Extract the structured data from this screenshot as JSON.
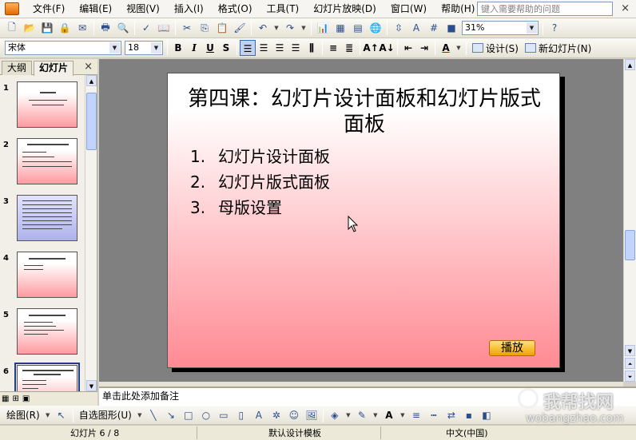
{
  "menubar": {
    "items": [
      "文件(F)",
      "编辑(E)",
      "视图(V)",
      "插入(I)",
      "格式(O)",
      "工具(T)",
      "幻灯片放映(D)",
      "窗口(W)",
      "帮助(H)"
    ],
    "help_placeholder": "键入需要帮助的问题",
    "close": "×"
  },
  "standard_toolbar": {
    "zoom": "31%",
    "help": "?"
  },
  "format_toolbar": {
    "font": "宋体",
    "size": "18",
    "bold": "B",
    "italic": "I",
    "underline": "U",
    "shadow": "S",
    "design": "设计(S)",
    "new_slide": "新幻灯片(N)"
  },
  "left_pane": {
    "tab_outline": "大纲",
    "tab_slides": "幻灯片",
    "close": "×",
    "thumbnails": [
      "1",
      "2",
      "3",
      "4",
      "5",
      "6"
    ]
  },
  "slide": {
    "title": "第四课：幻灯片设计面板和幻灯片版式面板",
    "items": [
      {
        "num": "1.",
        "text": "幻灯片设计面板"
      },
      {
        "num": "2.",
        "text": "幻灯片版式面板"
      },
      {
        "num": "3.",
        "text": "母版设置"
      }
    ],
    "play_button": "播放",
    "gradient_color": "#ff8a93"
  },
  "notes": {
    "placeholder": "单击此处添加备注"
  },
  "drawing_toolbar": {
    "draw": "绘图(R)",
    "autoshapes": "自选图形(U)"
  },
  "statusbar": {
    "slide_pos": "幻灯片 6 / 8",
    "design": "默认设计模板",
    "language": "中文(中国)"
  },
  "watermark": {
    "main": "我帮找网",
    "sub": "wobangzhao.com"
  }
}
